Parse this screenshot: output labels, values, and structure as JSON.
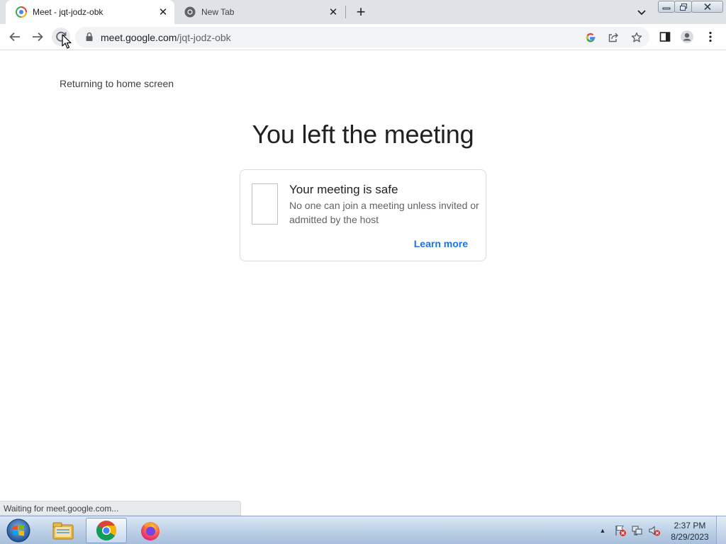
{
  "browser": {
    "tabs": [
      {
        "title": "Meet - jqt-jodz-obk",
        "favicon": "google-meet-favicon",
        "active": true
      },
      {
        "title": "New Tab",
        "favicon": "chrome-favicon",
        "active": false
      }
    ],
    "new_tab_symbol": "+",
    "close_symbol": "✕",
    "url_host": "meet.google.com",
    "url_path": "/jqt-jodz-obk"
  },
  "page": {
    "return_text": "Returning to home screen",
    "heading": "You left the meeting",
    "card": {
      "title": "Your meeting is safe",
      "body": "No one can join a meeting unless invited or admitted by the host",
      "link": "Learn more"
    }
  },
  "status_bar": {
    "text": "Waiting for meet.google.com..."
  },
  "taskbar": {
    "apps": [
      "windows-explorer",
      "google-chrome",
      "firefox"
    ],
    "tray_arrow": "▲",
    "time": "2:37 PM",
    "date": "8/29/2023"
  },
  "colors": {
    "tabstrip_bg": "#dfe3e8",
    "link_blue": "#1a73e8",
    "heading_text": "#202124",
    "muted_text": "#5f6368"
  }
}
